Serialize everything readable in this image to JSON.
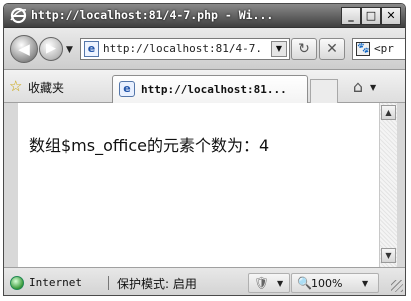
{
  "window": {
    "title": "http://localhost:81/4-7.php - Wi...",
    "minimize_icon": "_",
    "maximize_icon": "□",
    "close_icon": "✕"
  },
  "nav": {
    "back_icon": "back-arrow-icon",
    "forward_icon": "forward-arrow-icon",
    "address": "http://localhost:81/4-7.php",
    "search_text": "<pr"
  },
  "favorites": {
    "label": "收藏夹",
    "tab_label": "http://localhost:81..."
  },
  "content": {
    "text": "数组$ms_office的元素个数为：4"
  },
  "status": {
    "zone": "Internet",
    "protected_mode": "保护模式: 启用",
    "zoom": "100%"
  }
}
